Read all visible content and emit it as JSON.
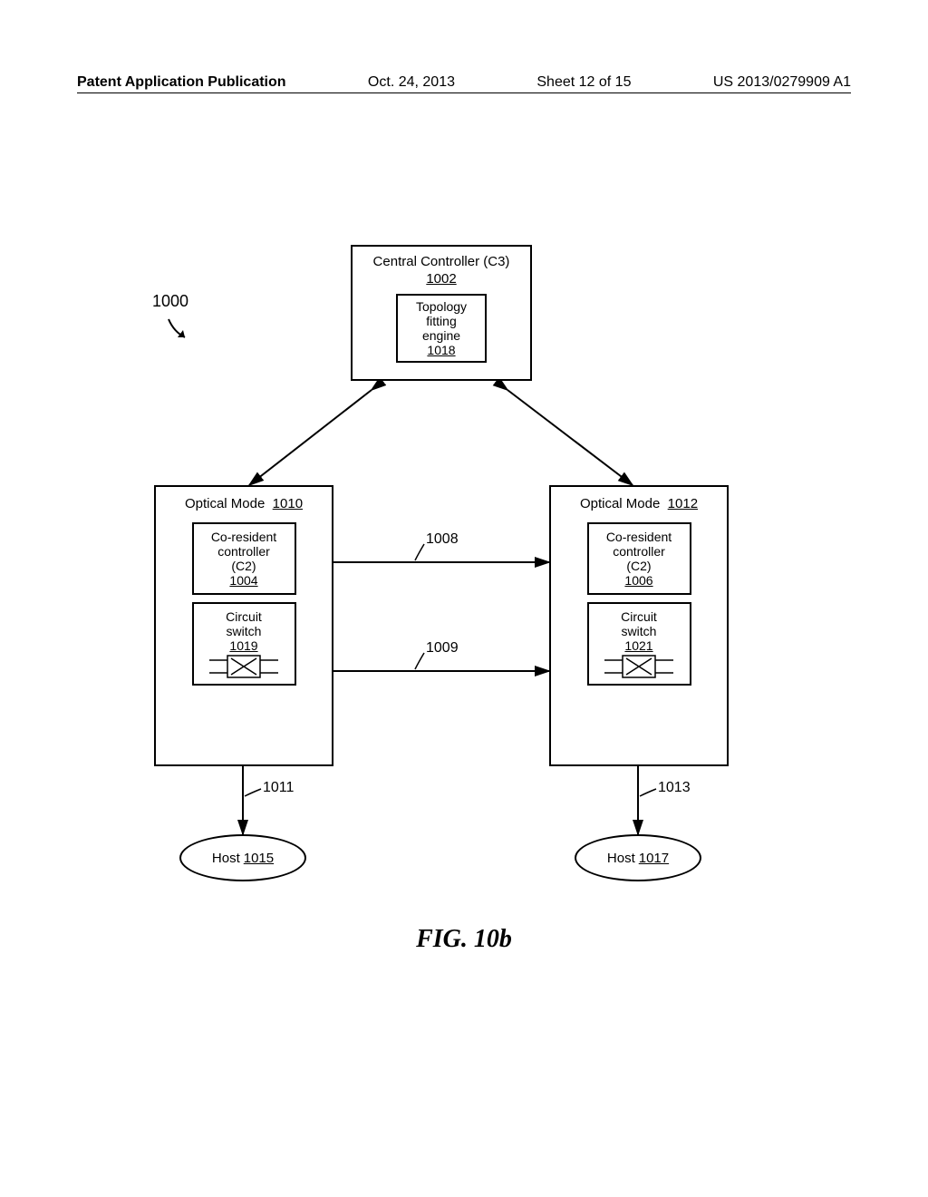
{
  "header": {
    "left": "Patent Application Publication",
    "date": "Oct. 24, 2013",
    "sheet": "Sheet 12 of 15",
    "pubno": "US 2013/0279909 A1"
  },
  "refs": {
    "r1000": "1000",
    "r1002": "1002",
    "r1004": "1004",
    "r1006": "1006",
    "r1008": "1008",
    "r1009": "1009",
    "r1010": "1010",
    "r1011": "1011",
    "r1012": "1012",
    "r1013": "1013",
    "r1015": "1015",
    "r1017": "1017",
    "r1018": "1018",
    "r1019": "1019",
    "r1021": "1021"
  },
  "central": {
    "title": "Central Controller (C3)",
    "topo_l1": "Topology",
    "topo_l2": "fitting",
    "topo_l3": "engine"
  },
  "node": {
    "left_title": "Optical Mode",
    "right_title": "Optical Mode",
    "ctrl_l1": "Co-resident",
    "ctrl_l2": "controller",
    "ctrl_l3": "(C2)",
    "switch_l1": "Circuit",
    "switch_l2": "switch"
  },
  "host": {
    "label": "Host"
  },
  "figure": {
    "caption": "FIG. 10b"
  }
}
